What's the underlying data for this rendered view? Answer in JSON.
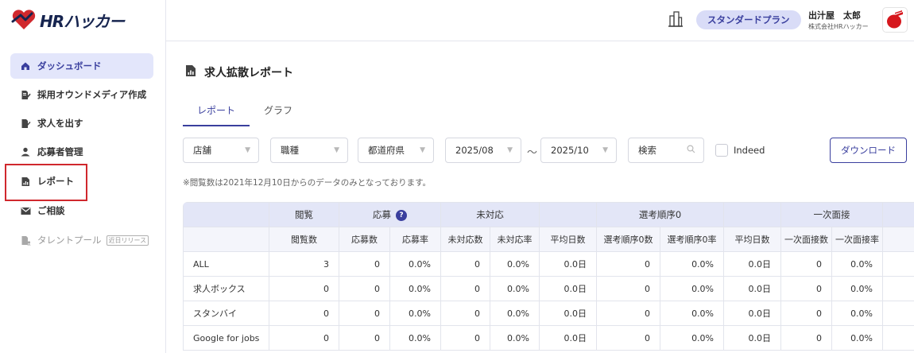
{
  "brand": {
    "name": "HRハッカー",
    "accent": "#3a3f9e",
    "logo_heart": "#d0282d"
  },
  "sidebar": {
    "items": [
      {
        "label": "ダッシュボード",
        "icon": "home-icon",
        "active": true
      },
      {
        "label": "採用オウンドメディア作成",
        "icon": "document-edit-icon"
      },
      {
        "label": "求人を出す",
        "icon": "document-pen-icon"
      },
      {
        "label": "応募者管理",
        "icon": "person-icon"
      },
      {
        "label": "レポート",
        "icon": "report-icon"
      },
      {
        "label": "ご相談",
        "icon": "mail-icon"
      },
      {
        "label": "タレントプール",
        "icon": "document-user-icon",
        "badge": "近日リリース",
        "disabled": true
      }
    ]
  },
  "header": {
    "plan": "スタンダードプラン",
    "user_name": "出汁屋　太郎",
    "company": "株式会社HRハッカー"
  },
  "page": {
    "title": "求人拡散レポート",
    "tabs": [
      "レポート",
      "グラフ"
    ]
  },
  "filters": {
    "store": "店舗",
    "job_type": "職種",
    "prefecture": "都道府県",
    "date_from": "2025/08",
    "tilde": "～",
    "date_to": "2025/10",
    "search_placeholder": "検索",
    "indeed_label": "Indeed",
    "download_label": "ダウンロード"
  },
  "note": "※閲覧数は2021年12月10日からのデータのみとなっております。",
  "table": {
    "groups": [
      "",
      "閲覧",
      "応募",
      "未対応",
      "",
      "選考順序0",
      "",
      "一次面接"
    ],
    "subheaders": [
      "",
      "閲覧数",
      "応募数",
      "応募率",
      "未対応数",
      "未対応率",
      "平均日数",
      "選考順序0数",
      "選考順序0率",
      "平均日数",
      "一次面接数",
      "一次面接率",
      ""
    ],
    "rows": [
      [
        "ALL",
        "3",
        "0",
        "0.0%",
        "0",
        "0.0%",
        "0.0日",
        "0",
        "0.0%",
        "0.0日",
        "0",
        "0.0%",
        ""
      ],
      [
        "求人ボックス",
        "0",
        "0",
        "0.0%",
        "0",
        "0.0%",
        "0.0日",
        "0",
        "0.0%",
        "0.0日",
        "0",
        "0.0%",
        ""
      ],
      [
        "スタンバイ",
        "0",
        "0",
        "0.0%",
        "0",
        "0.0%",
        "0.0日",
        "0",
        "0.0%",
        "0.0日",
        "0",
        "0.0%",
        ""
      ],
      [
        "Google for jobs",
        "0",
        "0",
        "0.0%",
        "0",
        "0.0%",
        "0.0日",
        "0",
        "0.0%",
        "0.0日",
        "0",
        "0.0%",
        ""
      ]
    ]
  }
}
